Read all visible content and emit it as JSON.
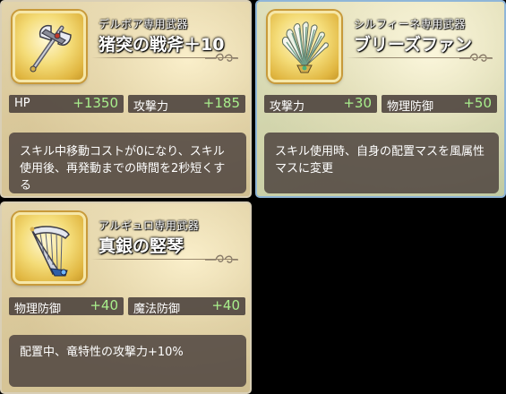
{
  "cards": [
    {
      "subtitle": "デルボア専用武器",
      "name": "猪突の戦斧＋10",
      "stats": [
        {
          "label": "HP",
          "value": "+1350"
        },
        {
          "label": "攻撃力",
          "value": "+185"
        }
      ],
      "description": "スキル中移動コストが0になり、スキル使用後、再発動までの時間を2秒短くする",
      "icon": "battle-axe-icon"
    },
    {
      "subtitle": "シルフィーネ専用武器",
      "name": "ブリーズファン",
      "stats": [
        {
          "label": "攻撃力",
          "value": "+30"
        },
        {
          "label": "物理防御",
          "value": "+50"
        }
      ],
      "description": "スキル使用時、自身の配置マスを風属性マスに変更",
      "icon": "feather-fan-icon"
    },
    {
      "subtitle": "アルギュロ専用武器",
      "name": "真銀の竪琴",
      "stats": [
        {
          "label": "物理防御",
          "value": "+40"
        },
        {
          "label": "魔法防御",
          "value": "+40"
        }
      ],
      "description": "配置中、竜特性の攻撃力+10%",
      "icon": "harp-icon"
    }
  ],
  "colors": {
    "stat_value": "#a9ef8c",
    "panel": "#4e443e",
    "frame_gold": "#e1b742",
    "card2_border": "#8fb6d8"
  }
}
